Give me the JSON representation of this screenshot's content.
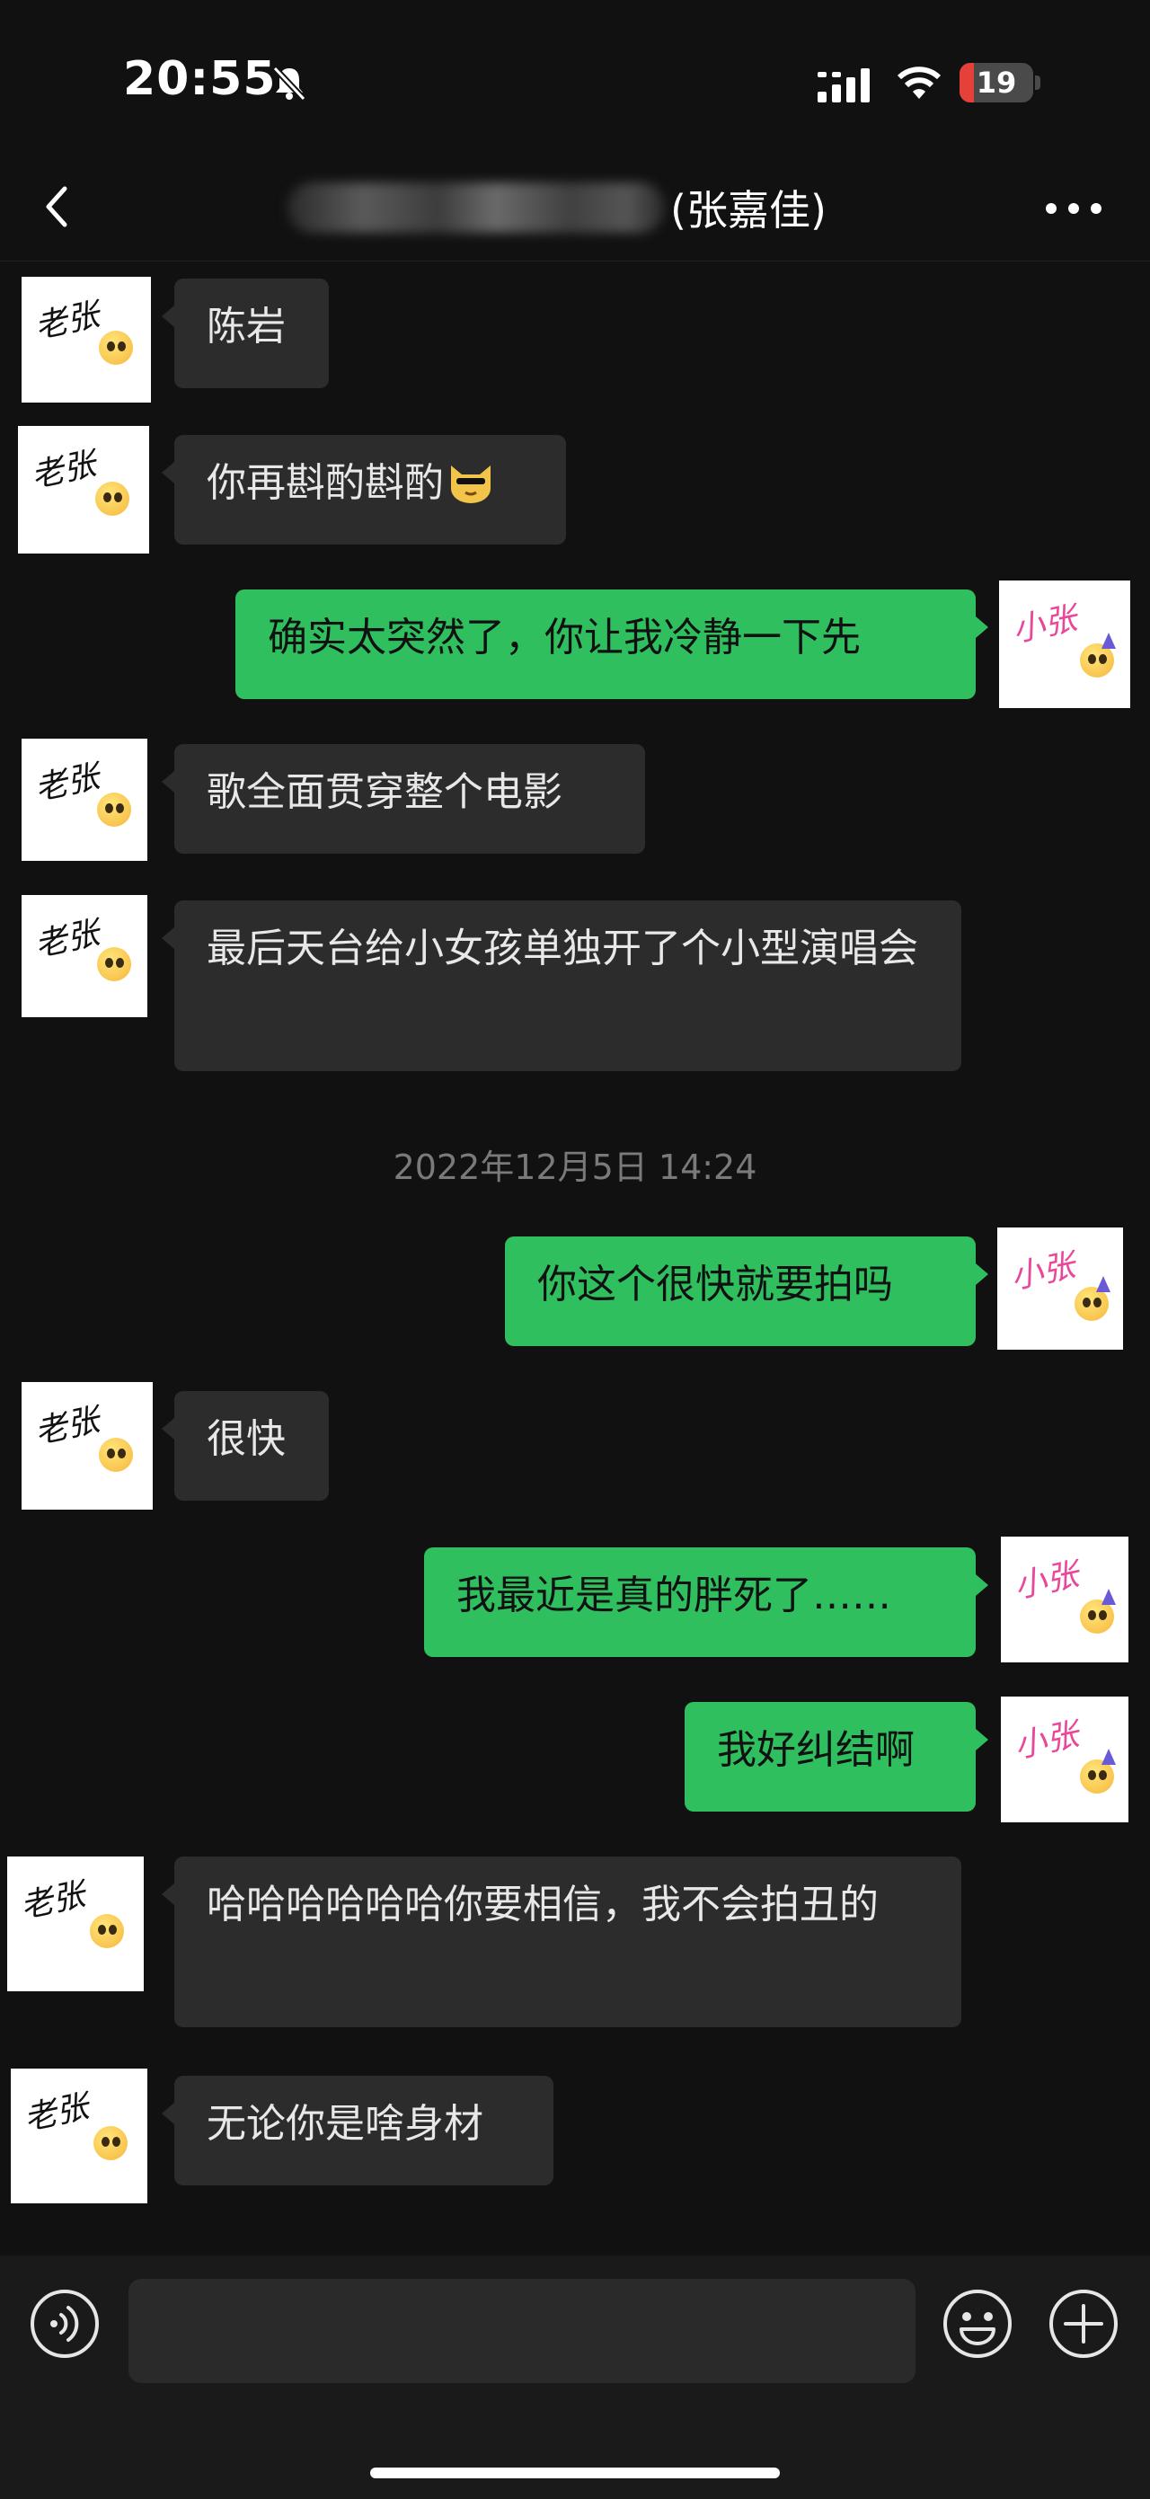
{
  "status_bar": {
    "time": "20:55",
    "battery_level": "19",
    "battery_fraction": 0.19
  },
  "header": {
    "title": "(张嘉佳)"
  },
  "avatars": {
    "contact": "老张",
    "self": "小张"
  },
  "messages": [
    {
      "sender": "contact",
      "text": "陈岩"
    },
    {
      "sender": "contact",
      "text": "你再斟酌斟酌",
      "emoji": "cat-face"
    },
    {
      "sender": "self",
      "text": "确实太突然了，你让我冷静一下先"
    },
    {
      "sender": "contact",
      "text": "歌全面贯穿整个电影"
    },
    {
      "sender": "contact",
      "text": "最后天台给小女孩单独开了个小型演唱会"
    },
    {
      "sender": "self",
      "text": "你这个很快就要拍吗"
    },
    {
      "sender": "contact",
      "text": "很快"
    },
    {
      "sender": "self",
      "text": "我最近是真的胖死了……"
    },
    {
      "sender": "self",
      "text": "我好纠结啊"
    },
    {
      "sender": "contact",
      "text": "哈哈哈哈哈哈你要相信，我不会拍丑的"
    },
    {
      "sender": "contact",
      "text": "无论你是啥身材"
    }
  ],
  "timestamp": "2022年12月5日 14:24",
  "input_bar": {
    "placeholder": ""
  },
  "icons": {
    "back": "chevron-left-icon",
    "more": "more-dots-icon",
    "voice": "voice-icon",
    "emoji": "emoji-icon",
    "plus": "plus-icon"
  },
  "colors": {
    "background": "#111111",
    "incoming_bubble": "#2c2c2c",
    "outgoing_bubble": "#2fbf5f"
  }
}
